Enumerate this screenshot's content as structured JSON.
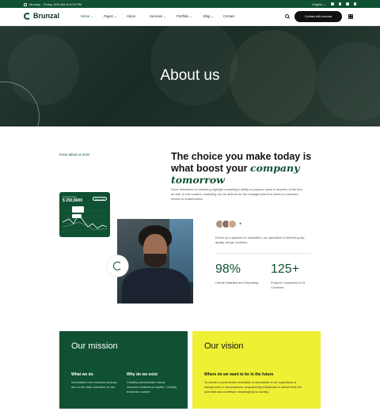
{
  "topbar": {
    "hours": "Monday - Friday, 8:00 AM to 6:00 PM",
    "language": "English",
    "colors": {
      "bar": "#0f5132"
    }
  },
  "nav": {
    "logo": "Brunzal",
    "items": [
      {
        "label": "Home",
        "dropdown": true,
        "active": true
      },
      {
        "label": "Pages",
        "dropdown": true
      },
      {
        "label": "About"
      },
      {
        "label": "Services",
        "dropdown": true
      },
      {
        "label": "Portfolio",
        "dropdown": true
      },
      {
        "label": "Blog",
        "dropdown": true
      },
      {
        "label": "Contact"
      }
    ],
    "cta": "Contact with brunzal",
    "icons": [
      "search-icon",
      "grid-menu-icon"
    ]
  },
  "hero": {
    "title": "About us"
  },
  "about": {
    "eyebrow": "Know about us more",
    "headline_plain": "The choice you make today is what boost your",
    "headline_italic": "company tomorrow",
    "description": "Gone definitions of marketing highlight marketing's ability to produce value to shareho of the firm as well. In this context, marketing can be defined as 'the management that seeks to maximize returns to shareholders",
    "card": {
      "label": "Overall Sales",
      "value": "$ 250,9600",
      "pill": "Last week"
    },
    "driven": "Driven by a passion for innovation, we specialize in delivering top-quality design solutions.",
    "stats": [
      {
        "value": "98%",
        "label": "Clients Satisfied and Repeating"
      },
      {
        "value": "125+",
        "label": "Projects Completed in 24 Countries"
      }
    ]
  },
  "mission": {
    "title": "Our mission",
    "columns": [
      {
        "heading": "What we do",
        "text": "Information love enhance journey due to the date collection on the."
      },
      {
        "heading": "Why do we exist",
        "text": "Credibly administrate robust resource intellectual capital. Credibly brand the market."
      }
    ]
  },
  "vision": {
    "title": "Our vision",
    "heading": "Where do we want to be in the future",
    "text": "To create a world where education is accessible to all, regardless of background or circumstance, empowering individuals to unlock their full potential and contribute meaningfully to society."
  }
}
